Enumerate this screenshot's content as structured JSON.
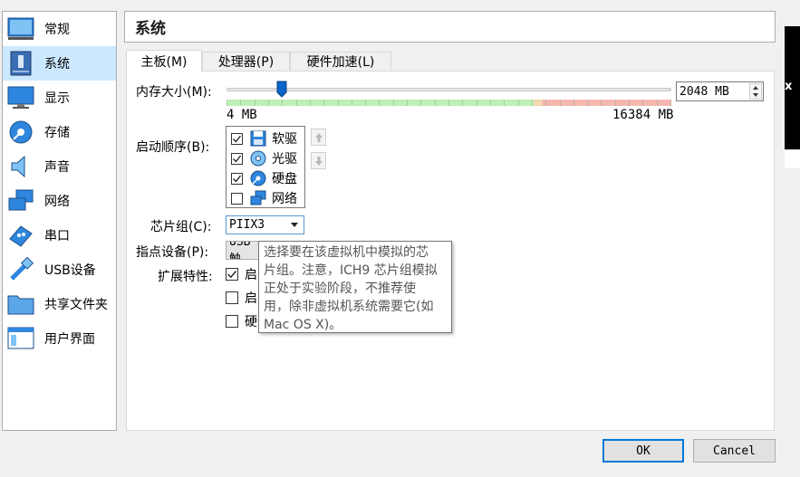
{
  "title": "系统",
  "sidebar": {
    "items": [
      {
        "label": "常规",
        "icon": "general-icon"
      },
      {
        "label": "系统",
        "icon": "system-icon"
      },
      {
        "label": "显示",
        "icon": "display-icon"
      },
      {
        "label": "存储",
        "icon": "storage-icon"
      },
      {
        "label": "声音",
        "icon": "audio-icon"
      },
      {
        "label": "网络",
        "icon": "network-icon"
      },
      {
        "label": "串口",
        "icon": "serial-port-icon"
      },
      {
        "label": "USB设备",
        "icon": "usb-icon"
      },
      {
        "label": "共享文件夹",
        "icon": "shared-folder-icon"
      },
      {
        "label": "用户界面",
        "icon": "user-interface-icon"
      }
    ],
    "selected_index": 1
  },
  "tabs": [
    {
      "label": "主板(M)"
    },
    {
      "label": "处理器(P)"
    },
    {
      "label": "硬件加速(L)"
    }
  ],
  "motherboard": {
    "memory_label": "内存大小(M):",
    "memory_value": "2048 MB",
    "memory_min": "4 MB",
    "memory_max": "16384 MB",
    "memory_fraction": 0.125,
    "boot_label": "启动顺序(B):",
    "boot_items": [
      {
        "label": "软驱",
        "checked": true,
        "icon": "floppy-icon"
      },
      {
        "label": "光驱",
        "checked": true,
        "icon": "optical-drive-icon"
      },
      {
        "label": "硬盘",
        "checked": true,
        "icon": "hard-disk-icon"
      },
      {
        "label": "网络",
        "checked": false,
        "icon": "network-icon"
      }
    ],
    "chipset_label": "芯片组(C):",
    "chipset_value": "PIIX3",
    "pointer_label": "指点设备(P):",
    "pointer_value": "USB触",
    "ext_label": "扩展特性:",
    "ext_items": [
      {
        "label": "启",
        "checked": true
      },
      {
        "label": "启",
        "checked": false
      },
      {
        "label": "硬",
        "checked": false
      }
    ]
  },
  "tooltip": {
    "lines": [
      "选择要在该虚拟机中模拟的芯",
      "片组。注意，ICH9 芯片组模拟",
      "正处于实验阶段，不推荐使",
      "用，除非虚拟机系统需要它(如",
      "Mac OS X)。"
    ]
  },
  "buttons": {
    "ok": "OK",
    "cancel": "Cancel"
  },
  "colors": {
    "selected_bg": "#cce8ff",
    "focus_blue": "#0078d7",
    "slider_handle": "#0a64c8"
  }
}
